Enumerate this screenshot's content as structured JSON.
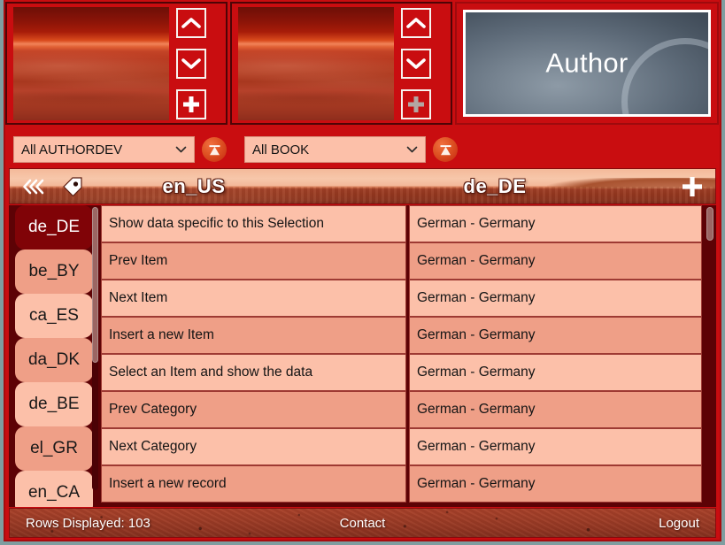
{
  "window": {
    "background_color": "#7f9da0",
    "frame_color": "#c90d10"
  },
  "top_panels": {
    "panel1": {
      "image_alt": "mars-horizon-thumbnail",
      "up_label": "chevron-up",
      "down_label": "chevron-down",
      "add_label": "plus",
      "add_enabled": true
    },
    "panel2": {
      "image_alt": "mars-horizon-thumbnail",
      "up_label": "chevron-up",
      "down_label": "chevron-down",
      "add_label": "plus",
      "add_enabled": false
    },
    "author_panel": {
      "label": "Author"
    }
  },
  "filters": [
    {
      "value": "All AUTHORDEV",
      "icon": "filter-funnel-icon"
    },
    {
      "value": "All BOOK",
      "icon": "filter-funnel-icon"
    }
  ],
  "header": {
    "back_icon": "double-chevron-left-icon",
    "tag_icon": "tag-icon",
    "add_icon": "plus-icon",
    "source_locale": "en_US",
    "target_locale": "de_DE"
  },
  "sidebar": {
    "selected": "de_DE",
    "items": [
      {
        "label": "de_DE",
        "selected": true
      },
      {
        "label": "be_BY",
        "selected": false
      },
      {
        "label": "ca_ES",
        "selected": false
      },
      {
        "label": "da_DK",
        "selected": false
      },
      {
        "label": "de_BE",
        "selected": false
      },
      {
        "label": "el_GR",
        "selected": false
      },
      {
        "label": "en_CA",
        "selected": false
      }
    ]
  },
  "table": {
    "rows": [
      {
        "key": "Show data specific to this Selection",
        "value": "German - Germany"
      },
      {
        "key": "Prev Item",
        "value": "German - Germany"
      },
      {
        "key": "Next Item",
        "value": "German - Germany"
      },
      {
        "key": "Insert a new Item",
        "value": "German - Germany"
      },
      {
        "key": "Select an Item and show the data",
        "value": "German - Germany"
      },
      {
        "key": "Prev Category",
        "value": "German - Germany"
      },
      {
        "key": "Next Category",
        "value": "German - Germany"
      },
      {
        "key": "Insert a new record",
        "value": "German - Germany"
      }
    ]
  },
  "footer": {
    "rows_displayed": "Rows Displayed: 103",
    "contact": "Contact",
    "logout": "Logout"
  }
}
